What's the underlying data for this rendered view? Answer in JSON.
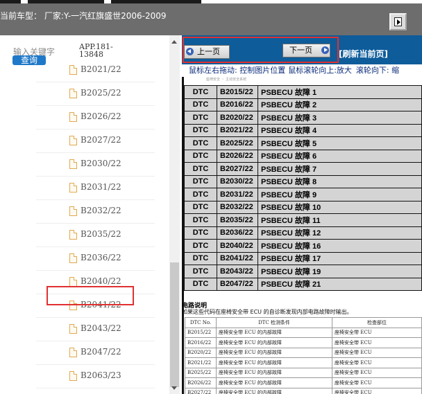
{
  "header": {
    "title": "当前车型： 厂家:Y-一汽红旗盛世2006-2009"
  },
  "search": {
    "label": "输入关键字",
    "button": "查询",
    "appno": "APP.181-13848"
  },
  "tree": {
    "items": [
      "B2021/22",
      "B2025/22",
      "B2026/22",
      "B2027/22",
      "B2030/22",
      "B2031/22",
      "B2032/22",
      "B2035/22",
      "B2036/22",
      "B2040/22",
      "B2041/22",
      "B2043/22",
      "B2047/22",
      "B2063/23"
    ],
    "selected": "B2036/22"
  },
  "nav": {
    "prev": "上一页",
    "next": "下一页",
    "refresh": "[刷新当前页]",
    "hint": [
      "鼠标左右拖动: 控制图片位置",
      "鼠标滚轮向上:放大",
      "滚轮向下: 缩"
    ]
  },
  "doc": {
    "header": "座椅安全 ・ 主动安全系统",
    "rows": [
      [
        "DTC",
        "B2015/22",
        "PSBECU 故障 1"
      ],
      [
        "DTC",
        "B2016/22",
        "PSBECU 故障 2"
      ],
      [
        "DTC",
        "B2020/22",
        "PSBECU 故障 3"
      ],
      [
        "DTC",
        "B2021/22",
        "PSBECU 故障 4"
      ],
      [
        "DTC",
        "B2025/22",
        "PSBECU 故障 5"
      ],
      [
        "DTC",
        "B2026/22",
        "PSBECU 故障 6"
      ],
      [
        "DTC",
        "B2027/22",
        "PSBECU 故障 7"
      ],
      [
        "DTC",
        "B2030/22",
        "PSBECU 故障 8"
      ],
      [
        "DTC",
        "B2031/22",
        "PSBECU 故障 9"
      ],
      [
        "DTC",
        "B2032/22",
        "PSBECU 故障 10"
      ],
      [
        "DTC",
        "B2035/22",
        "PSBECU 故障 11"
      ],
      [
        "DTC",
        "B2036/22",
        "PSBECU 故障 12"
      ],
      [
        "DTC",
        "B2040/22",
        "PSBECU 故障 16"
      ],
      [
        "DTC",
        "B2041/22",
        "PSBECU 故障 17"
      ],
      [
        "DTC",
        "B2043/22",
        "PSBECU 故障 19"
      ],
      [
        "DTC",
        "B2047/22",
        "PSBECU 故障 21"
      ]
    ],
    "section_title": "电路说明",
    "section_desc": "如果这些代码在座椅安全带 ECU 的自诊断发现内部电路故障时输出。",
    "lower_headers": [
      "DTC No.",
      "DTC 检测条件",
      "检查部位"
    ],
    "lower_rows": [
      [
        "B2015/22",
        "座椅安全带 ECU 的内部故障",
        "座椅安全带 ECU"
      ],
      [
        "B2016/22",
        "座椅安全带 ECU 的内部故障",
        "座椅安全带 ECU"
      ],
      [
        "B2020/22",
        "座椅安全带 ECU 的内部故障",
        "座椅安全带 ECU"
      ],
      [
        "B2021/22",
        "座椅安全带 ECU 的内部故障",
        "座椅安全带 ECU"
      ],
      [
        "B2025/22",
        "座椅安全带 ECU 的内部故障",
        "座椅安全带 ECU"
      ],
      [
        "B2026/22",
        "座椅安全带 ECU 的内部故障",
        "座椅安全带 ECU"
      ],
      [
        "B2027/22",
        "座椅安全带 ECU 的内部故障",
        "座椅安全带 ECU"
      ]
    ]
  }
}
